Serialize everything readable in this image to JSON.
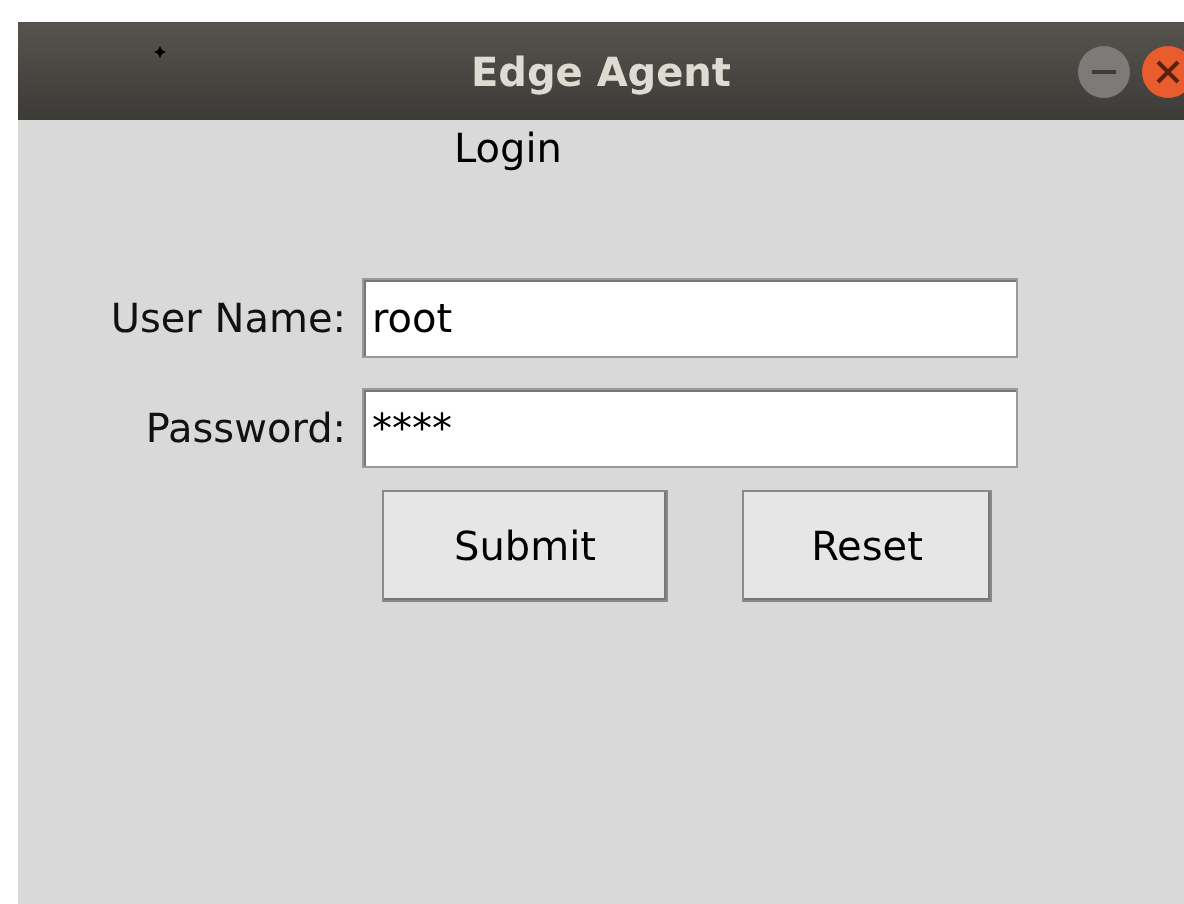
{
  "window": {
    "title": "Edge Agent"
  },
  "heading": "Login",
  "fields": [
    {
      "label": "User Name:",
      "value": "root"
    },
    {
      "label": "Password:",
      "value": "****"
    }
  ],
  "buttons": [
    "Submit",
    "Reset"
  ]
}
